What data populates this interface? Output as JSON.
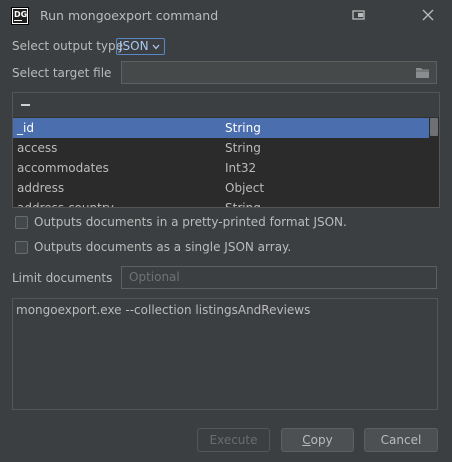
{
  "window": {
    "title": "Run mongoexport command",
    "logo_text_line1": "DG",
    "icons": {
      "logo": "datagrip-logo",
      "restore": "restore-window-icon",
      "close": "close-icon"
    }
  },
  "output_type": {
    "label": "Select output type",
    "value": "JSON"
  },
  "target_file": {
    "label": "Select target file",
    "value": "",
    "icon": "folder-icon"
  },
  "fields": {
    "rows": [
      {
        "name": "_id",
        "type": "String",
        "selected": true
      },
      {
        "name": "access",
        "type": "String"
      },
      {
        "name": "accommodates",
        "type": "Int32"
      },
      {
        "name": "address",
        "type": "Object"
      },
      {
        "name": "address.country",
        "type": "String"
      }
    ]
  },
  "options": {
    "pretty_print": {
      "label": "Outputs documents in a pretty-printed format JSON.",
      "checked": false
    },
    "json_array": {
      "label": "Outputs documents as a single JSON array.",
      "checked": false
    }
  },
  "limit": {
    "label": "Limit documents",
    "placeholder": "Optional",
    "value": ""
  },
  "command": "mongoexport.exe --collection listingsAndReviews",
  "buttons": {
    "execute": {
      "label": "Execute",
      "enabled": false
    },
    "copy": {
      "label": "Copy",
      "mnemonic": "C"
    },
    "cancel": {
      "label": "Cancel"
    }
  },
  "colors": {
    "background": "#3c3f41",
    "selection": "#4b6eaf",
    "accent": "#5b87c7"
  }
}
